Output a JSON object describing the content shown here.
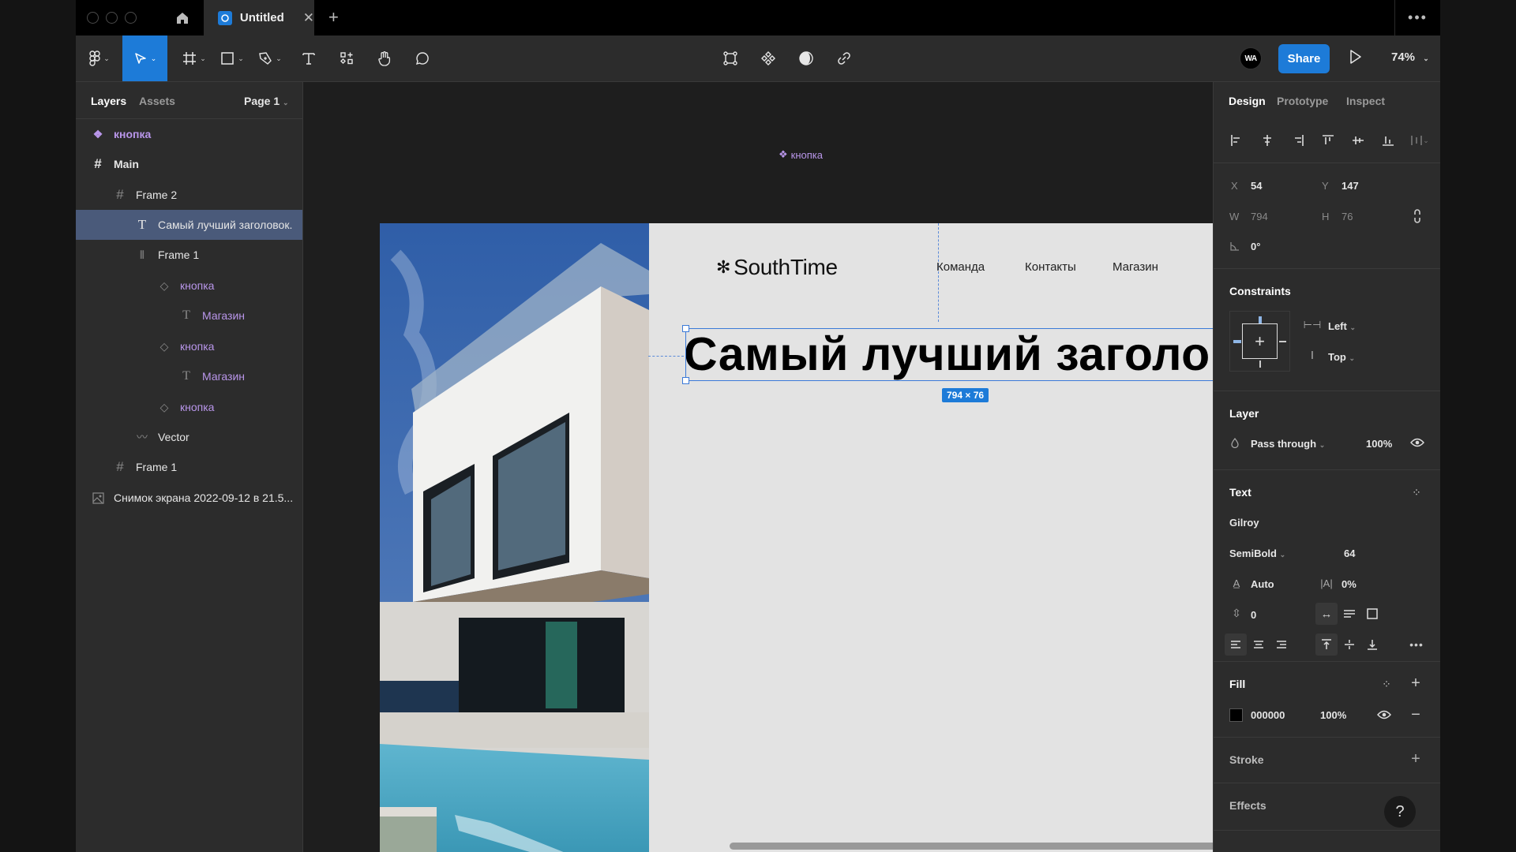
{
  "tabbar": {
    "tab_title": "Untitled",
    "close_glyph": "✕",
    "new_tab_glyph": "+",
    "more_glyph": "•••"
  },
  "toolbar": {
    "tools": [
      "main-menu",
      "move",
      "frame",
      "shape",
      "pen",
      "text",
      "resources",
      "hand",
      "comment"
    ],
    "center_tools": [
      "component-set",
      "component",
      "contrast",
      "link"
    ],
    "avatar_initials": "WA",
    "share_label": "Share",
    "zoom_level": "74%",
    "accent_color": "#1d7bd8"
  },
  "left_panel": {
    "tabs": [
      "Layers",
      "Assets"
    ],
    "page_selector": "Page 1",
    "layers": [
      {
        "name": "кнопка",
        "type": "component",
        "depth": 0,
        "selected": false
      },
      {
        "name": "Main",
        "type": "frame",
        "depth": 0,
        "selected": false
      },
      {
        "name": "Frame 2",
        "type": "frame",
        "depth": 1,
        "selected": false
      },
      {
        "name": "Самый лучший заголовок.",
        "type": "text",
        "depth": 2,
        "selected": true
      },
      {
        "name": "Frame 1",
        "type": "autolayout",
        "depth": 2,
        "selected": false
      },
      {
        "name": "кнопка",
        "type": "instance",
        "depth": 3,
        "selected": false
      },
      {
        "name": "Магазин",
        "type": "text",
        "depth": 4,
        "selected": false
      },
      {
        "name": "кнопка",
        "type": "instance",
        "depth": 3,
        "selected": false
      },
      {
        "name": "Магазин",
        "type": "text",
        "depth": 4,
        "selected": false
      },
      {
        "name": "кнопка",
        "type": "instance",
        "depth": 3,
        "selected": false
      },
      {
        "name": "Vector",
        "type": "vector",
        "depth": 2,
        "selected": false
      },
      {
        "name": "Frame 1",
        "type": "frame",
        "depth": 1,
        "selected": false
      },
      {
        "name": "Снимок экрана 2022-09-12 в 21.5...",
        "type": "image",
        "depth": 0,
        "selected": false
      }
    ]
  },
  "canvas": {
    "component_label": "кнопка",
    "site": {
      "logo": "SouthTime",
      "nav": [
        "Команда",
        "Контакты",
        "Магазин"
      ],
      "headline": "Самый лучший заголовок."
    },
    "selection_size": "794 × 76"
  },
  "right_panel": {
    "tabs": [
      "Design",
      "Prototype",
      "Inspect"
    ],
    "active_tab": "Design",
    "position": {
      "x_label": "X",
      "x": "54",
      "y_label": "Y",
      "y": "147",
      "w_label": "W",
      "w": "794",
      "h_label": "H",
      "h": "76",
      "rotation": "0°"
    },
    "constraints": {
      "title": "Constraints",
      "horizontal": "Left",
      "vertical": "Top"
    },
    "layer": {
      "title": "Layer",
      "blend": "Pass through",
      "opacity": "100%"
    },
    "text": {
      "title": "Text",
      "font_family": "Gilroy",
      "font_weight": "SemiBold",
      "font_size": "64",
      "line_height": "Auto",
      "letter_spacing": "0%",
      "paragraph_spacing": "0"
    },
    "fill": {
      "title": "Fill",
      "hex": "000000",
      "opacity": "100%",
      "swatch_color": "#000000"
    },
    "stroke": {
      "title": "Stroke"
    },
    "effects": {
      "title": "Effects"
    },
    "help_glyph": "?"
  }
}
